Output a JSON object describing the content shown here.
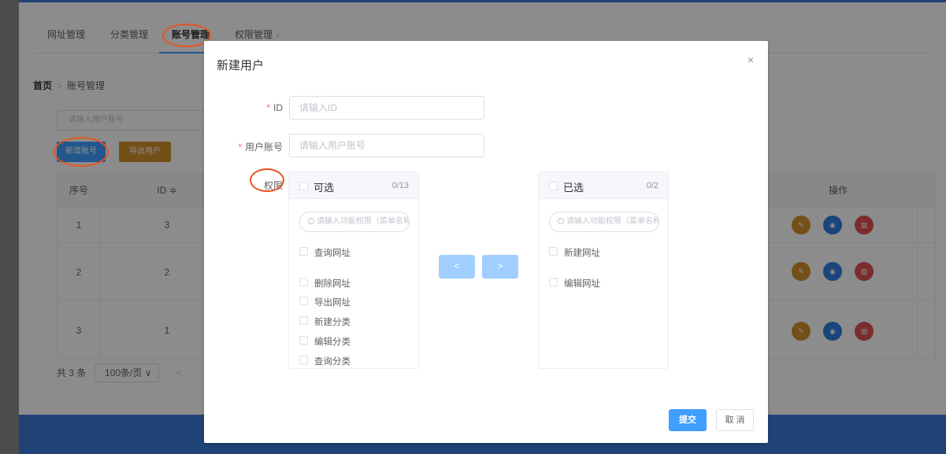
{
  "tabs": [
    {
      "label": "网址管理"
    },
    {
      "label": "分类管理"
    },
    {
      "label": "账号管理"
    },
    {
      "label": "权限管理"
    }
  ],
  "tab_dropdown_glyph": "∨",
  "breadcrumb": {
    "home": "首页",
    "separator": ">",
    "current": "账号管理"
  },
  "search": {
    "placeholder": "请输入用户账号"
  },
  "actions": {
    "add_label": "新增账号",
    "export_label": "导出用户"
  },
  "table": {
    "headers": [
      "序号",
      "ID ≑",
      "操作"
    ],
    "rows": [
      {
        "index": "1",
        "id": "3"
      },
      {
        "index": "2",
        "id": "2"
      },
      {
        "index": "3",
        "id": "1"
      }
    ]
  },
  "pagination": {
    "total": "共 3 条",
    "page_size": "100条/页 ∨",
    "prev": "<"
  },
  "dialog": {
    "title": "新建用户",
    "close": "×",
    "required_mark": "*",
    "id_label": "ID",
    "id_placeholder": "请输入ID",
    "account_label": "用户账号",
    "account_placeholder": "请输入用户账号",
    "permission_label": "权限",
    "left_panel": {
      "title": "可选",
      "count": "0/13",
      "search_placeholder": "请输入功能权限（菜单名称）",
      "items": [
        "查询网址",
        "删除网址",
        "导出网址",
        "新建分类",
        "编辑分类",
        "查询分类"
      ]
    },
    "right_panel": {
      "title": "已选",
      "count": "0/2",
      "search_placeholder": "请输入功能权限（菜单名称）",
      "items": [
        "新建网址",
        "编辑网址"
      ]
    },
    "move_left": "<",
    "move_right": ">",
    "submit_label": "提交",
    "cancel_label": "取 消"
  },
  "colors": {
    "primary": "#409eff",
    "warning": "#d4912d",
    "danger": "#e05252",
    "annotation": "#e8541e",
    "footer": "#3a7bd5"
  },
  "icons": {
    "edit": "edit-icon",
    "view": "eye-icon",
    "delete": "trash-icon",
    "sort": "sort-icon",
    "search": "search-icon",
    "close": "close-icon"
  }
}
